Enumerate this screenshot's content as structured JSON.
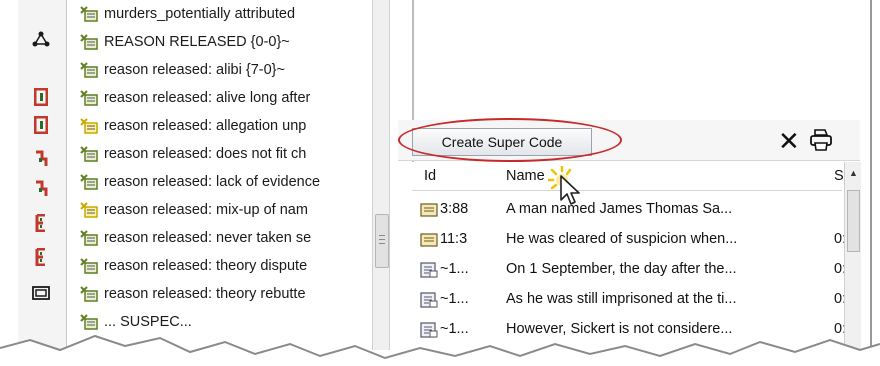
{
  "code_tree": {
    "items": [
      {
        "label": "murders_potentially attributed",
        "icon": "code-icon"
      },
      {
        "label": "REASON RELEASED {0-0}~",
        "icon": "code-icon"
      },
      {
        "label": "reason released: alibi {7-0}~",
        "icon": "code-icon"
      },
      {
        "label": "reason released: alive long after",
        "icon": "code-icon"
      },
      {
        "label": "reason released: allegation unp",
        "icon": "code-icon-yellow"
      },
      {
        "label": "reason released: does not fit ch",
        "icon": "code-icon"
      },
      {
        "label": "reason released: lack of evidence",
        "icon": "code-icon"
      },
      {
        "label": "reason released: mix-up of nam",
        "icon": "code-icon-yellow"
      },
      {
        "label": "reason released: never taken se",
        "icon": "code-icon"
      },
      {
        "label": "reason released: theory dispute",
        "icon": "code-icon"
      },
      {
        "label": "reason released: theory rebutte",
        "icon": "code-icon"
      },
      {
        "label": "... SUSPEC...",
        "icon": "code-icon"
      }
    ]
  },
  "toolstrip": {
    "icons": [
      "network-icon",
      "code-bracket-red-icon",
      "code-bracket-red-icon",
      "code-bracket-red-small-icon",
      "code-bracket-red-small-icon",
      "code-segment-icon",
      "code-segment-icon",
      "document-frame-icon"
    ]
  },
  "toolbar": {
    "create_super_code_label": "Create Super Code",
    "delete_icon": "close-icon",
    "print_icon": "printer-icon"
  },
  "quotations": {
    "columns": [
      "Id",
      "Name",
      "S"
    ],
    "rows": [
      {
        "id": "3:88",
        "name": "A man named James Thomas Sa...",
        "s": "",
        "icon": "quote-doc-icon"
      },
      {
        "id": "11:3",
        "name": "He was cleared of suspicion when...",
        "s": "0:",
        "icon": "quote-doc-icon"
      },
      {
        "id": "~1...",
        "name": "On 1 September, the day after the...",
        "s": "0:",
        "icon": "memo-doc-icon"
      },
      {
        "id": "~1...",
        "name": "As he was still imprisoned at the ti...",
        "s": "0:",
        "icon": "memo-doc-icon"
      },
      {
        "id": "~1...",
        "name": "However, Sickert is not considere...",
        "s": "0:",
        "icon": "memo-doc-icon"
      }
    ]
  },
  "colors": {
    "highlight_oval": "#c72a2a",
    "code_icon_green": "#6a8a2a",
    "code_icon_yellow": "#d6b200",
    "tool_red": "#c0392b"
  }
}
